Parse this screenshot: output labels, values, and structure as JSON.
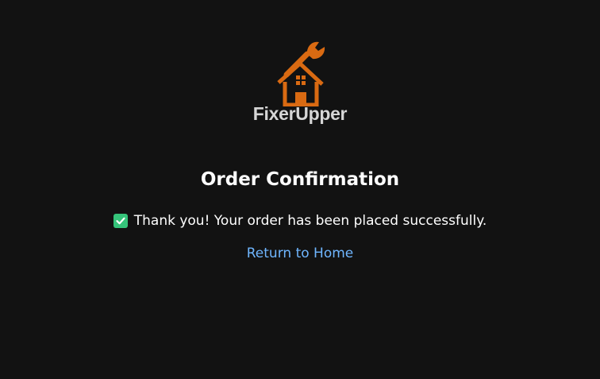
{
  "brand": {
    "name": "FixerUpper",
    "logo_icon": "house-wrench-icon",
    "logo_color": "#d96a12",
    "name_color": "#d6d6d6"
  },
  "page": {
    "title": "Order Confirmation",
    "success_icon": "check-icon",
    "success_color": "#35c47a",
    "message": "Thank you! Your order has been placed successfully.",
    "home_link_label": "Return to Home",
    "link_color": "#6fb6ff",
    "background_color": "#121212"
  }
}
